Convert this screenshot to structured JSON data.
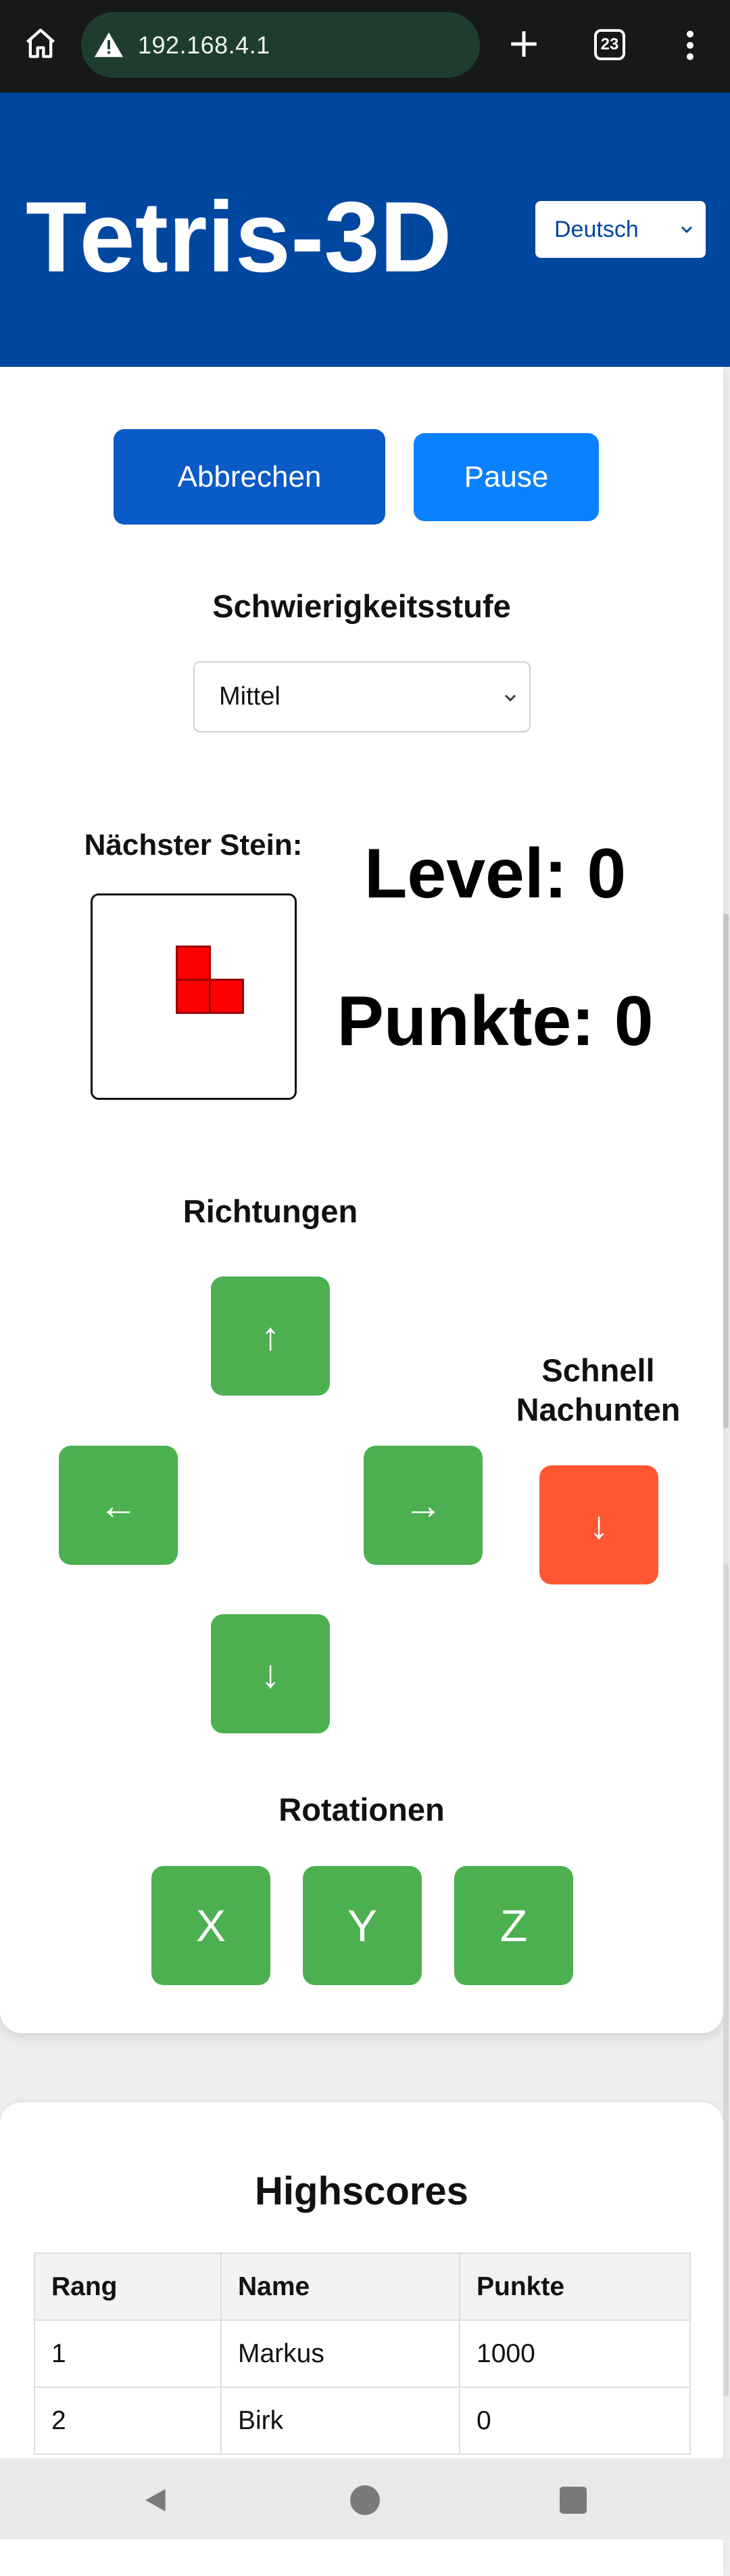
{
  "browser": {
    "url": "192.168.4.1",
    "tab_count": "23"
  },
  "header": {
    "title": "Tetris-3D",
    "language": "Deutsch"
  },
  "controls": {
    "cancel_label": "Abbrechen",
    "pause_label": "Pause",
    "difficulty_label": "Schwierigkeitsstufe",
    "difficulty_value": "Mittel"
  },
  "game": {
    "next_label": "Nächster Stein:",
    "level_text": "Level: 0",
    "points_text": "Punkte: 0",
    "piece_color": "#ff0000"
  },
  "directions": {
    "label": "Richtungen",
    "up": "↑",
    "left": "←",
    "right": "→",
    "down": "↓",
    "fast_label": "Schnell Nachunten",
    "fast_symbol": "↓"
  },
  "rotations": {
    "label": "Rotationen",
    "x": "X",
    "y": "Y",
    "z": "Z"
  },
  "highscores": {
    "title": "Highscores",
    "headers": [
      "Rang",
      "Name",
      "Punkte"
    ],
    "rows": [
      [
        "1",
        "Markus",
        "1000"
      ],
      [
        "2",
        "Birk",
        "0"
      ]
    ]
  },
  "colors": {
    "header_bg": "#0047a0",
    "arrow_green": "#4caf50",
    "fast_orange": "#ff5733",
    "cancel_blue": "#0a5ac8",
    "pause_blue": "#0a82ff"
  }
}
